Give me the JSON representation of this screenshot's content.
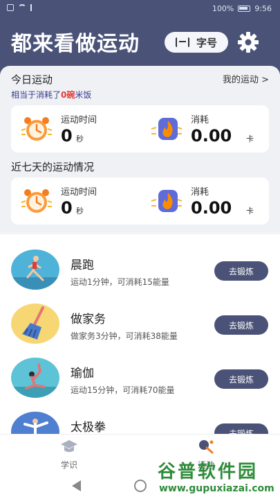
{
  "status_bar": {
    "battery": "100%",
    "time": "9:56"
  },
  "header": {
    "title": "都来看做运动",
    "font_button_label": "字号"
  },
  "today": {
    "heading": "今日运动",
    "my_sports_link": "我的运动 >",
    "subtitle_prefix": "相当于消耗了",
    "subtitle_highlight": "0碗",
    "subtitle_suffix": "米饭",
    "duration_label": "运动时间",
    "duration_value": "0",
    "duration_unit": "秒",
    "burn_label": "消耗",
    "burn_value": "0.00",
    "burn_unit": "卡"
  },
  "week": {
    "heading": "近七天的运动情况",
    "duration_label": "运动时间",
    "duration_value": "0",
    "duration_unit": "秒",
    "burn_label": "消耗",
    "burn_value": "0.00",
    "burn_unit": "卡"
  },
  "exercises": [
    {
      "name": "晨跑",
      "desc": "运动1分钟，可消耗15能量",
      "button": "去锻炼"
    },
    {
      "name": "做家务",
      "desc": "做家务3分钟，可消耗38能量",
      "button": "去锻炼"
    },
    {
      "name": "瑜伽",
      "desc": "运动15分钟，可消耗70能量",
      "button": "去锻炼"
    },
    {
      "name": "太极拳",
      "desc": "",
      "button": "去锻炼"
    }
  ],
  "bottom_nav": {
    "study_label": "学识",
    "sport_label": "运动"
  },
  "watermark": {
    "title": "谷普软件园",
    "url": "www.gupuxiazai.com"
  },
  "colors": {
    "header_bg": "#4a5377",
    "accent_red": "#e53935",
    "button_bg": "#4a5377"
  }
}
